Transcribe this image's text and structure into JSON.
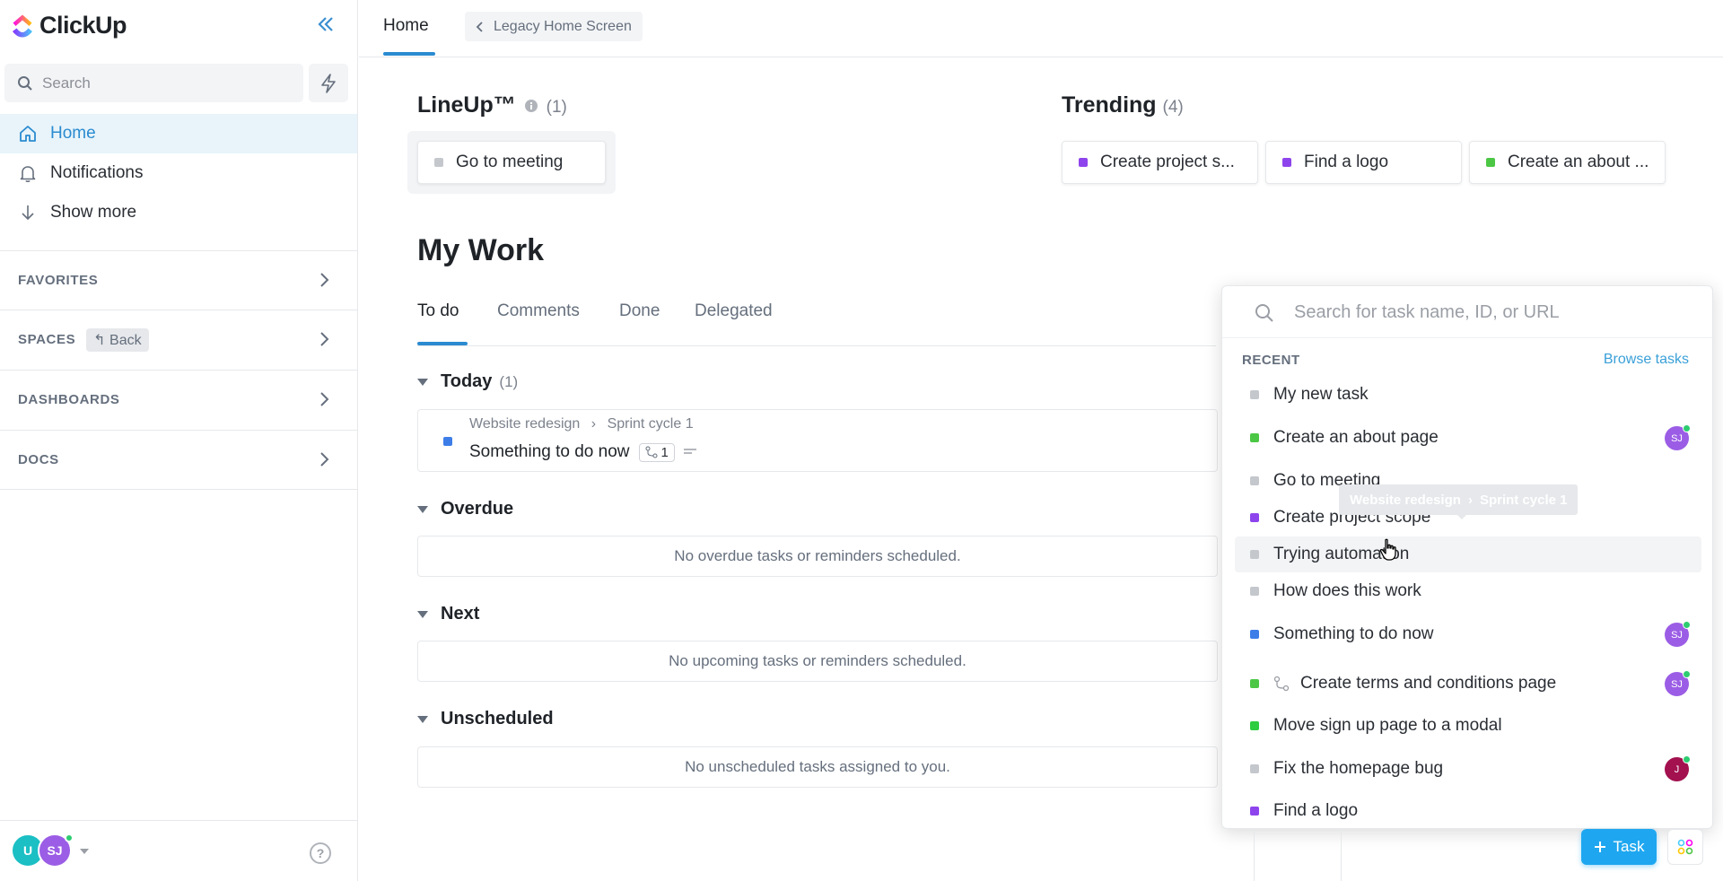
{
  "brand": {
    "name": "ClickUp"
  },
  "sidebar": {
    "search_placeholder": "Search",
    "nav": [
      {
        "label": "Home",
        "icon": "home-icon"
      },
      {
        "label": "Notifications",
        "icon": "bell-icon"
      },
      {
        "label": "Show more",
        "icon": "arrow-down-icon"
      }
    ],
    "sections": [
      {
        "label": "FAVORITES"
      },
      {
        "label": "SPACES",
        "chip": "Back"
      },
      {
        "label": "DASHBOARDS"
      },
      {
        "label": "DOCS"
      }
    ],
    "footer": {
      "avatar_u": "U",
      "avatar_sj": "SJ"
    }
  },
  "topbar": {
    "tab": "Home",
    "legacy": "Legacy Home Screen"
  },
  "lineup": {
    "title": "LineUp™",
    "count": "(1)",
    "items": [
      {
        "label": "Go to meeting",
        "color": "#c4c7cc"
      }
    ]
  },
  "trending": {
    "title": "Trending",
    "count": "(4)",
    "items": [
      {
        "label": "Create project s...",
        "color": "#8e44ec"
      },
      {
        "label": "Find a logo",
        "color": "#8e44ec"
      },
      {
        "label": "Create an about ...",
        "color": "#4cc745"
      }
    ]
  },
  "mywork": {
    "title": "My Work",
    "tabs": [
      "To do",
      "Comments",
      "Done",
      "Delegated"
    ],
    "groups": {
      "today": {
        "label": "Today",
        "count": "(1)",
        "crumb_a": "Website redesign",
        "crumb_b": "Sprint cycle 1",
        "task": "Something to do now",
        "subtasks": "1"
      },
      "overdue": {
        "label": "Overdue",
        "empty": "No overdue tasks or reminders scheduled."
      },
      "next": {
        "label": "Next",
        "empty": "No upcoming tasks or reminders scheduled."
      },
      "unscheduled": {
        "label": "Unscheduled",
        "empty": "No unscheduled tasks assigned to you."
      }
    }
  },
  "dropdown": {
    "search_placeholder": "Search for task name, ID, or URL",
    "recent_label": "RECENT",
    "browse_label": "Browse tasks",
    "items": [
      {
        "label": "My new task",
        "color": "#c4c7cc",
        "avatar": ""
      },
      {
        "label": "Create an about page",
        "color": "#4cc745",
        "avatar": "SJ"
      },
      {
        "label": "Go to meeting",
        "color": "#c4c7cc",
        "avatar": ""
      },
      {
        "label": "Create project scope",
        "color": "#8e44ec",
        "avatar": ""
      },
      {
        "label": "Trying automation",
        "color": "#c4c7cc",
        "avatar": ""
      },
      {
        "label": "How does this work",
        "color": "#c4c7cc",
        "avatar": ""
      },
      {
        "label": "Something to do now",
        "color": "#3d7de8",
        "avatar": "SJ"
      },
      {
        "label": "Create terms and conditions page",
        "color": "#4cc745",
        "avatar": "SJ"
      },
      {
        "label": "Move sign up page to a modal",
        "color": "#2ecc40",
        "avatar": ""
      },
      {
        "label": "Fix the homepage bug",
        "color": "#c4c7cc",
        "avatar": "J"
      },
      {
        "label": "Find a logo",
        "color": "#8e44ec",
        "avatar": ""
      }
    ],
    "tooltip_a": "Website redesign",
    "tooltip_b": "Sprint cycle 1"
  },
  "fab": {
    "task_label": "Task"
  },
  "colors": {
    "accent": "#2a8bd0",
    "avatar_purple": "#9b5de5",
    "avatar_teal": "#1bbfc4",
    "avatar_maroon": "#a3114f"
  }
}
